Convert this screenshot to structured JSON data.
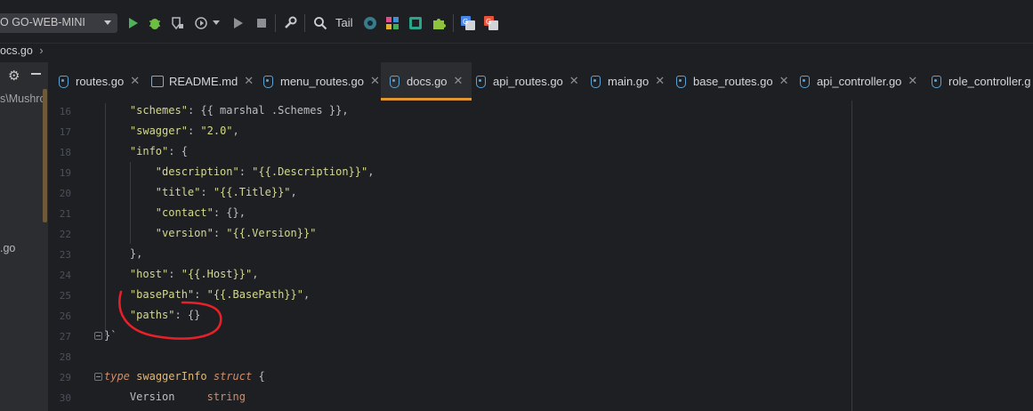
{
  "toolbar": {
    "run_config": "O GO-WEB-MINI",
    "tail_label": "Tail",
    "accent_run": "#4fb35b",
    "accent_debug": "#6cbf43"
  },
  "breadcrumb": "ocs.go",
  "project_panel": {
    "path": "s\\Mushro",
    "file": ".go"
  },
  "tabs": [
    {
      "label": "routes.go",
      "icon": "go-file-icon"
    },
    {
      "label": "README.md",
      "icon": "markdown-file-icon"
    },
    {
      "label": "menu_routes.go",
      "icon": "go-file-icon"
    },
    {
      "label": "docs.go",
      "icon": "go-file-icon",
      "active": true
    },
    {
      "label": "api_routes.go",
      "icon": "go-file-icon"
    },
    {
      "label": "main.go",
      "icon": "go-file-icon"
    },
    {
      "label": "base_routes.go",
      "icon": "go-file-icon"
    },
    {
      "label": "api_controller.go",
      "icon": "go-file-icon"
    },
    {
      "label": "role_controller.g",
      "icon": "go-file-icon"
    }
  ],
  "editor": {
    "line_numbers": [
      "16",
      "17",
      "18",
      "19",
      "20",
      "21",
      "22",
      "23",
      "24",
      "25",
      "26",
      "27",
      "28",
      "29",
      "30"
    ],
    "lines": [
      "    \"schemes\": {{ marshal .Schemes }},",
      "    \"swagger\": \"2.0\",",
      "    \"info\": {",
      "        \"description\": \"{{.Description}}\",",
      "        \"title\": \"{{.Title}}\",",
      "        \"contact\": {},",
      "        \"version\": \"{{.Version}}\"",
      "    },",
      "    \"host\": \"{{.Host}}\",",
      "    \"basePath\": \"{{.BasePath}}\",",
      "    \"paths\": {}",
      "}`",
      "",
      "type swaggerInfo struct {",
      "    Version     string"
    ]
  },
  "annotation_color": "#e8202a"
}
